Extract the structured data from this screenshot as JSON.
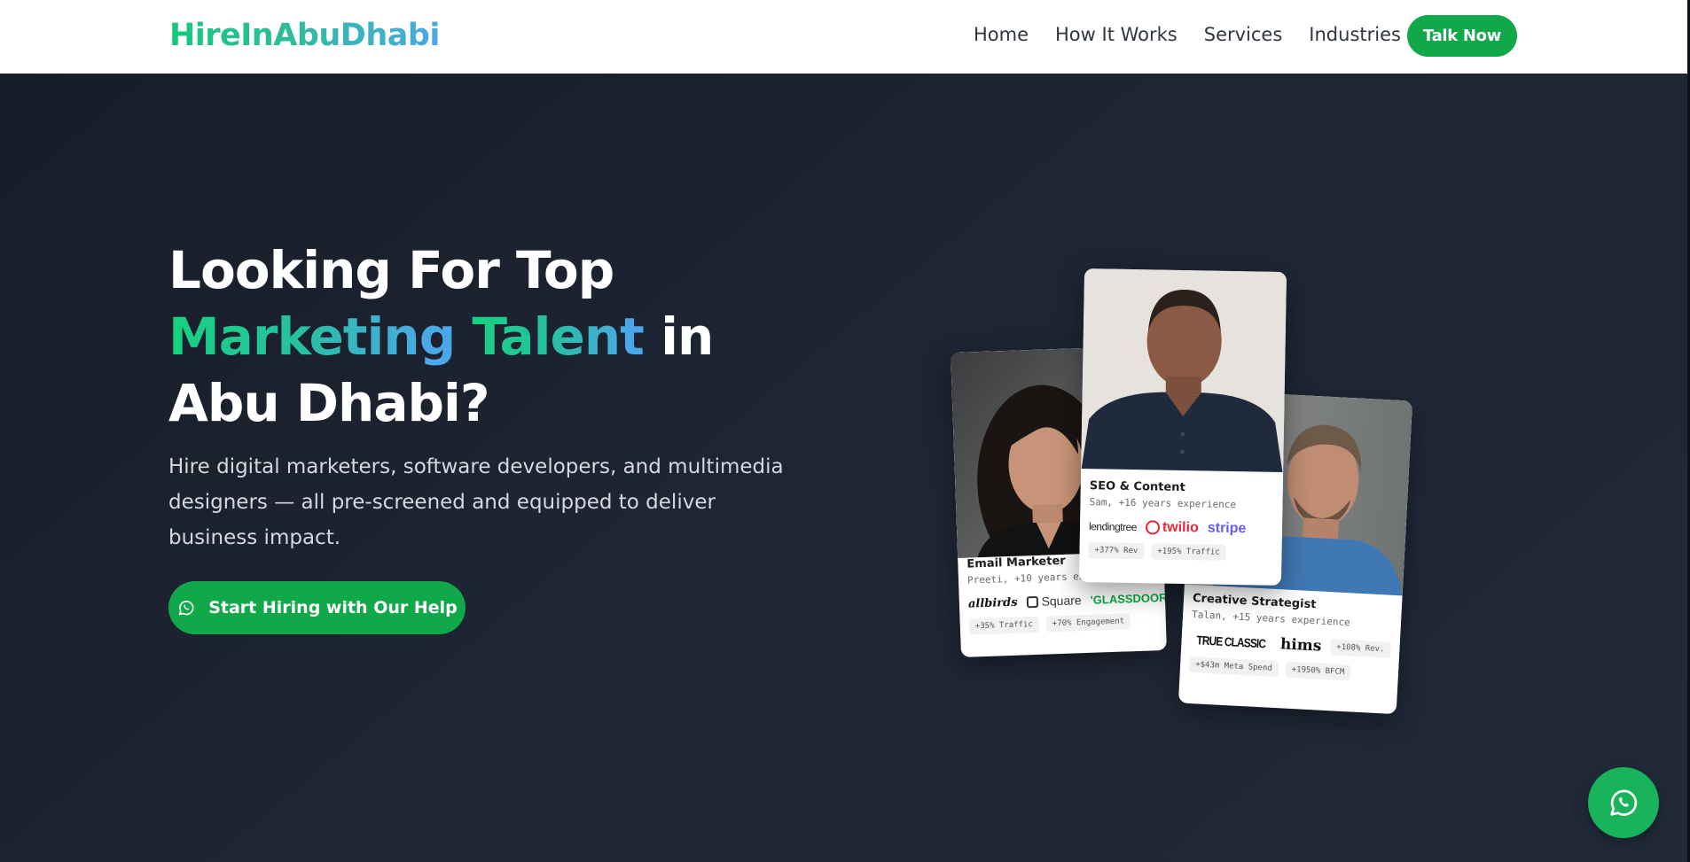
{
  "brand": {
    "name": "HireInAbuDhabi"
  },
  "nav": {
    "links": [
      "Home",
      "How It Works",
      "Services",
      "Industries"
    ],
    "cta": "Talk Now"
  },
  "hero": {
    "headline_line1": "Looking For Top",
    "headline_highlight1": "Marketing",
    "headline_highlight2": "Talent",
    "headline_in": " in",
    "headline_line3": "Abu Dhabi?",
    "subtext": "Hire digital marketers, software developers, and multimedia designers — all pre-screened and equipped to deliver business impact.",
    "cta": "Start Hiring with Our Help"
  },
  "cards": {
    "email": {
      "title": "Email Marketer",
      "subtitle": "Preeti, +10 years experience",
      "logos": [
        "allbirds",
        "Square",
        "'GLASSDOOR'"
      ],
      "tags": [
        "+35% Traffic",
        "+70% Engagement"
      ]
    },
    "seo": {
      "title": "SEO & Content",
      "subtitle": "Sam, +16 years experience",
      "logos": [
        "lendingtree",
        "twilio",
        "stripe"
      ],
      "tags": [
        "+377% Rev",
        "+195% Traffic"
      ]
    },
    "creative": {
      "title": "Creative Strategist",
      "subtitle": "Talan, +15 years experience",
      "logos": [
        "TRUE CLASSIC",
        "hims"
      ],
      "tags": [
        "+108% Rev.",
        "+$43m Meta Spend",
        "+1950% BFCM"
      ]
    }
  },
  "colors": {
    "accent_green": "#11a84a",
    "gradient_start": "#17d27f",
    "gradient_end": "#4aa8e8",
    "hero_bg": "#1e2533"
  },
  "icons": {
    "whatsapp": "whatsapp-icon"
  }
}
